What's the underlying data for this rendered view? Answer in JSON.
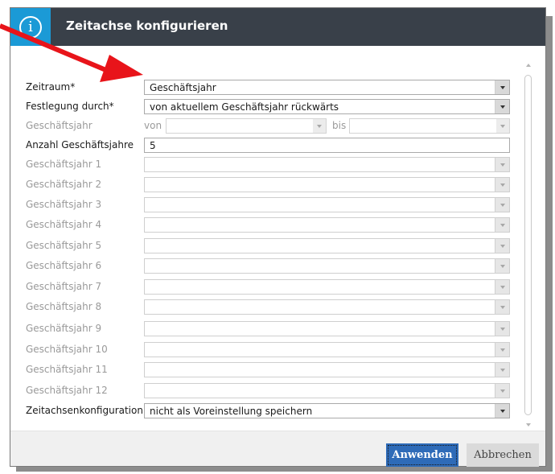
{
  "dialog": {
    "title": "Zeitachse konfigurieren",
    "info_icon": "info-icon"
  },
  "form": {
    "zeitraum": {
      "label": "Zeitraum*",
      "value": "Geschäftsjahr"
    },
    "festlegung": {
      "label": "Festlegung durch*",
      "value": "von aktuellem Geschäftsjahr rückwärts"
    },
    "geschaeftsjahr_range": {
      "label": "Geschäftsjahr",
      "von_label": "von",
      "von_value": "",
      "bis_label": "bis",
      "bis_value": ""
    },
    "anzahl": {
      "label": "Anzahl Geschäftsjahre",
      "value": "5"
    },
    "years": [
      {
        "label": "Geschäftsjahr 1",
        "value": ""
      },
      {
        "label": "Geschäftsjahr 2",
        "value": ""
      },
      {
        "label": "Geschäftsjahr 3",
        "value": ""
      },
      {
        "label": "Geschäftsjahr 4",
        "value": ""
      },
      {
        "label": "Geschäftsjahr 5",
        "value": ""
      },
      {
        "label": "Geschäftsjahr 6",
        "value": ""
      },
      {
        "label": "Geschäftsjahr 7",
        "value": ""
      },
      {
        "label": "Geschäftsjahr 8",
        "value": ""
      },
      {
        "label": "Geschäftsjahr 9",
        "value": ""
      },
      {
        "label": "Geschäftsjahr 10",
        "value": ""
      },
      {
        "label": "Geschäftsjahr 11",
        "value": ""
      },
      {
        "label": "Geschäftsjahr 12",
        "value": ""
      }
    ],
    "zeitachsenkonfiguration": {
      "label": "Zeitachsenkonfiguration",
      "value": "nicht als Voreinstellung speichern"
    }
  },
  "footer": {
    "apply_label": "Anwenden",
    "cancel_label": "Abbrechen"
  },
  "colors": {
    "titlebar": "#394049",
    "info_accent": "#1b9ad6",
    "apply_button": "#2e6bb8",
    "annotation_arrow": "#e8141a"
  }
}
